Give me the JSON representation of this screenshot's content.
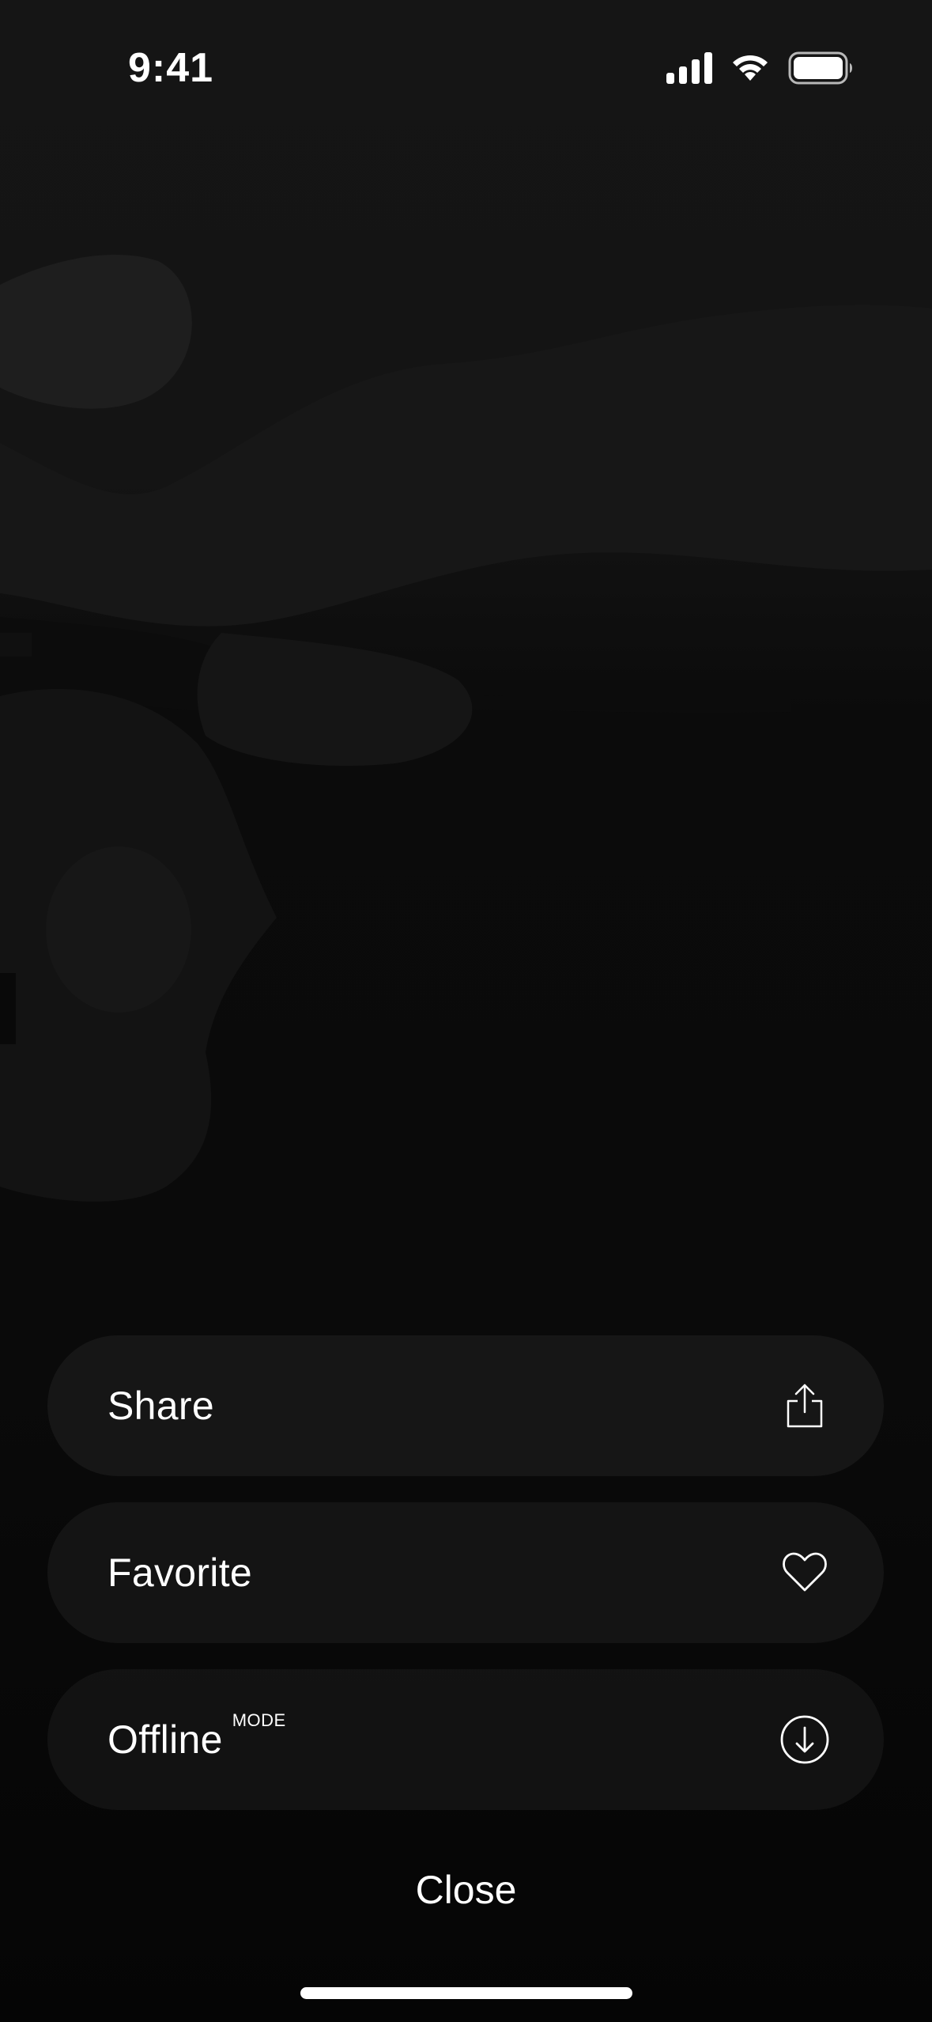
{
  "status_bar": {
    "time": "9:41",
    "icons": [
      "cellular-signal-icon",
      "wifi-icon",
      "battery-icon"
    ]
  },
  "sheet": {
    "items": [
      {
        "label": "Share",
        "superscript": "",
        "icon": "share-icon"
      },
      {
        "label": "Favorite",
        "superscript": "",
        "icon": "heart-icon"
      },
      {
        "label": "Offline",
        "superscript": "MODE",
        "icon": "download-circle-icon"
      }
    ],
    "close_label": "Close"
  },
  "colors": {
    "background": "#0a0a0a",
    "sheet_item": "#181818",
    "text": "#ffffff"
  }
}
